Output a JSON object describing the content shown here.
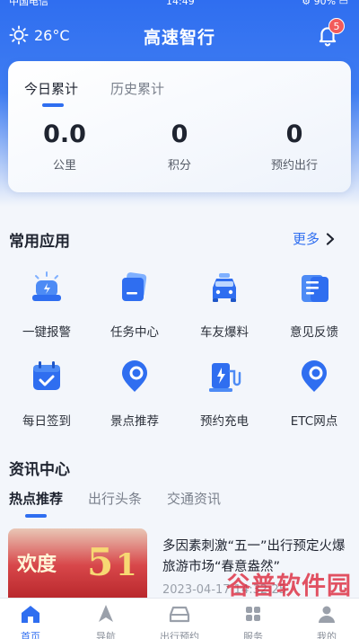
{
  "status_bar": {
    "carrier": "中国电信 ⌃",
    "time": "14:49",
    "battery": "⚙ 90% ▭"
  },
  "header": {
    "temperature": "26°C",
    "title": "高速智行",
    "notification_count": "5"
  },
  "stats": {
    "tabs": [
      "今日累计",
      "历史累计"
    ],
    "items": [
      {
        "value": "0.0",
        "label": "公里"
      },
      {
        "value": "0",
        "label": "积分"
      },
      {
        "value": "0",
        "label": "预约出行"
      }
    ]
  },
  "common_apps": {
    "title": "常用应用",
    "more": "更多",
    "items": [
      {
        "label": "一键报警",
        "icon": "alarm-icon"
      },
      {
        "label": "任务中心",
        "icon": "task-icon"
      },
      {
        "label": "车友爆料",
        "icon": "car-report-icon"
      },
      {
        "label": "意见反馈",
        "icon": "feedback-icon"
      },
      {
        "label": "每日签到",
        "icon": "calendar-check-icon"
      },
      {
        "label": "景点推荐",
        "icon": "location-pin-icon"
      },
      {
        "label": "预约充电",
        "icon": "charging-icon"
      },
      {
        "label": "ETC网点",
        "icon": "etc-pin-icon"
      }
    ]
  },
  "news": {
    "title": "资讯中心",
    "tabs": [
      "热点推荐",
      "出行头条",
      "交通资讯"
    ],
    "items": [
      {
        "thumb_text": "欢度",
        "title": "多因素刺激“五一”出行预定火爆 旅游市场“春意盎然”",
        "time": "2023-04-17 14:32:25"
      }
    ]
  },
  "watermark": {
    "text": "谷普软件园",
    "url": "www.gupuxiazai.com"
  },
  "tab_bar": {
    "items": [
      "首页",
      "导航",
      "出行预约",
      "服务",
      "我的"
    ]
  },
  "colors": {
    "accent": "#2f6ef0",
    "badge": "#f25b5b"
  }
}
